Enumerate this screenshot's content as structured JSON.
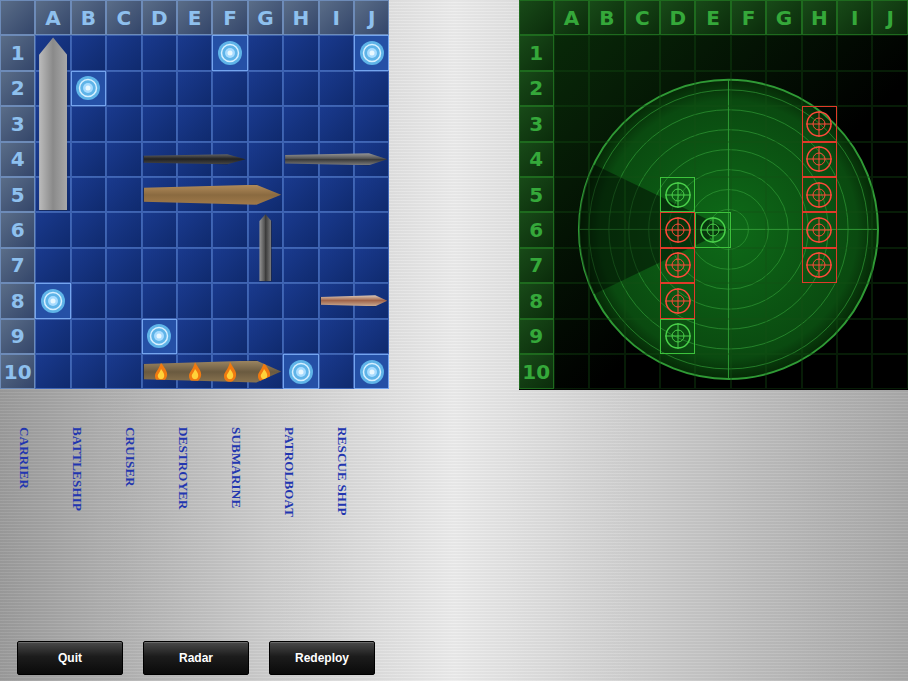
{
  "columns": [
    "A",
    "B",
    "C",
    "D",
    "E",
    "F",
    "G",
    "H",
    "I",
    "J"
  ],
  "rows": [
    "1",
    "2",
    "3",
    "4",
    "5",
    "6",
    "7",
    "8",
    "9",
    "10"
  ],
  "fleet_board": {
    "ships": [
      {
        "kind": "carrier",
        "start": "A1",
        "length": 5,
        "orientation": "vertical",
        "on_fire": false
      },
      {
        "kind": "submarine",
        "start": "D4",
        "length": 3,
        "orientation": "horizontal",
        "on_fire": false
      },
      {
        "kind": "destroyer",
        "start": "H4",
        "length": 3,
        "orientation": "horizontal",
        "on_fire": false
      },
      {
        "kind": "battleship",
        "start": "D5",
        "length": 4,
        "orientation": "horizontal",
        "on_fire": false
      },
      {
        "kind": "patrolboat",
        "start": "G6",
        "length": 2,
        "orientation": "vertical",
        "on_fire": false
      },
      {
        "kind": "rescue",
        "start": "I8",
        "length": 2,
        "orientation": "horizontal",
        "on_fire": false
      },
      {
        "kind": "cruiser",
        "start": "D10",
        "length": 4,
        "orientation": "horizontal",
        "on_fire": true
      }
    ],
    "misses": [
      "F1",
      "J1",
      "B2",
      "A8",
      "D9",
      "H10",
      "J10"
    ]
  },
  "radar_board": {
    "shots": [
      {
        "cell": "H3",
        "hit": true
      },
      {
        "cell": "H4",
        "hit": true
      },
      {
        "cell": "H5",
        "hit": true
      },
      {
        "cell": "H6",
        "hit": true
      },
      {
        "cell": "H7",
        "hit": true
      },
      {
        "cell": "D5",
        "hit": false
      },
      {
        "cell": "D6",
        "hit": true
      },
      {
        "cell": "E6",
        "hit": false
      },
      {
        "cell": "D7",
        "hit": true
      },
      {
        "cell": "D8",
        "hit": true
      },
      {
        "cell": "D9",
        "hit": false
      }
    ]
  },
  "ship_list": [
    "CARRIER",
    "BATTLESHIP",
    "CRUISER",
    "DESTROYER",
    "SUBMARINE",
    "PATROLBOAT",
    "RESCUE SHIP"
  ],
  "buttons": [
    "Quit",
    "Radar",
    "Redeploy"
  ]
}
